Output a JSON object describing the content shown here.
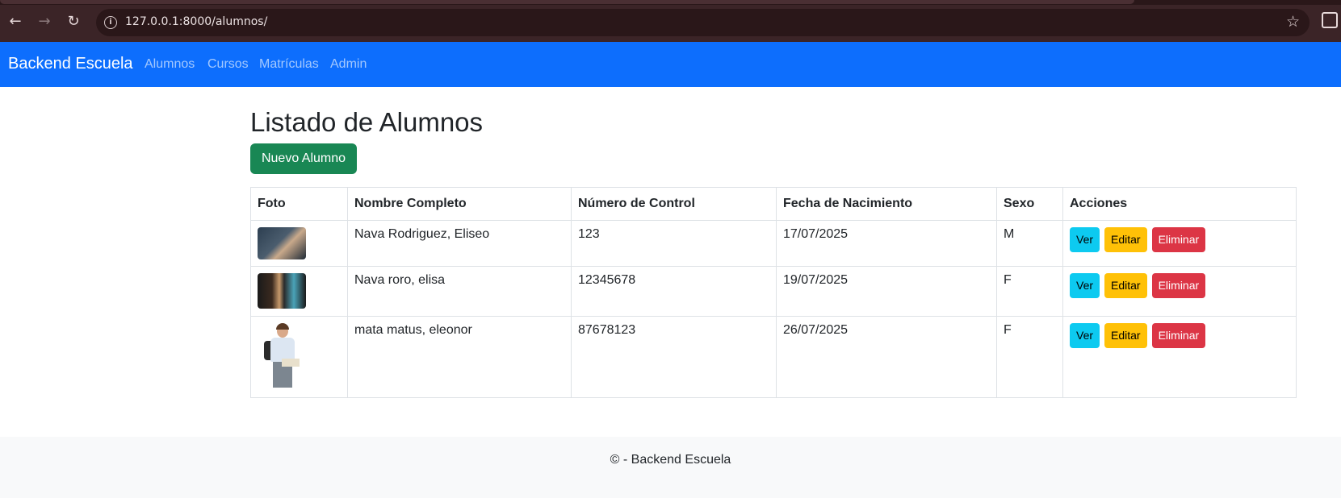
{
  "browser": {
    "url": "127.0.0.1:8000/alumnos/",
    "icons": [
      "back-arrow-icon",
      "forward-arrow-icon",
      "reload-icon",
      "info-icon",
      "star-icon",
      "extensions-icon"
    ]
  },
  "navbar": {
    "brand": "Backend Escuela",
    "links": [
      "Alumnos",
      "Cursos",
      "Matrículas",
      "Admin"
    ],
    "color": "#0d6efd"
  },
  "main": {
    "title": "Listado de Alumnos",
    "new_button": "Nuevo Alumno",
    "table": {
      "headers": [
        "Foto",
        "Nombre Completo",
        "Número de Control",
        "Fecha de Nacimiento",
        "Sexo",
        "Acciones"
      ],
      "rows": [
        {
          "nombre": "Nava Rodriguez, Eliseo",
          "numero": "123",
          "fecha": "17/07/2025",
          "sexo": "M"
        },
        {
          "nombre": "Nava roro, elisa",
          "numero": "12345678",
          "fecha": "19/07/2025",
          "sexo": "F"
        },
        {
          "nombre": "mata matus, eleonor",
          "numero": "87678123",
          "fecha": "26/07/2025",
          "sexo": "F"
        }
      ],
      "actions": {
        "ver": "Ver",
        "editar": "Editar",
        "eliminar": "Eliminar"
      }
    }
  },
  "footer": {
    "text": "© - Backend Escuela"
  },
  "colors": {
    "success": "#198754",
    "info": "#0dcaf0",
    "warning": "#ffc107",
    "danger": "#dc3545"
  }
}
